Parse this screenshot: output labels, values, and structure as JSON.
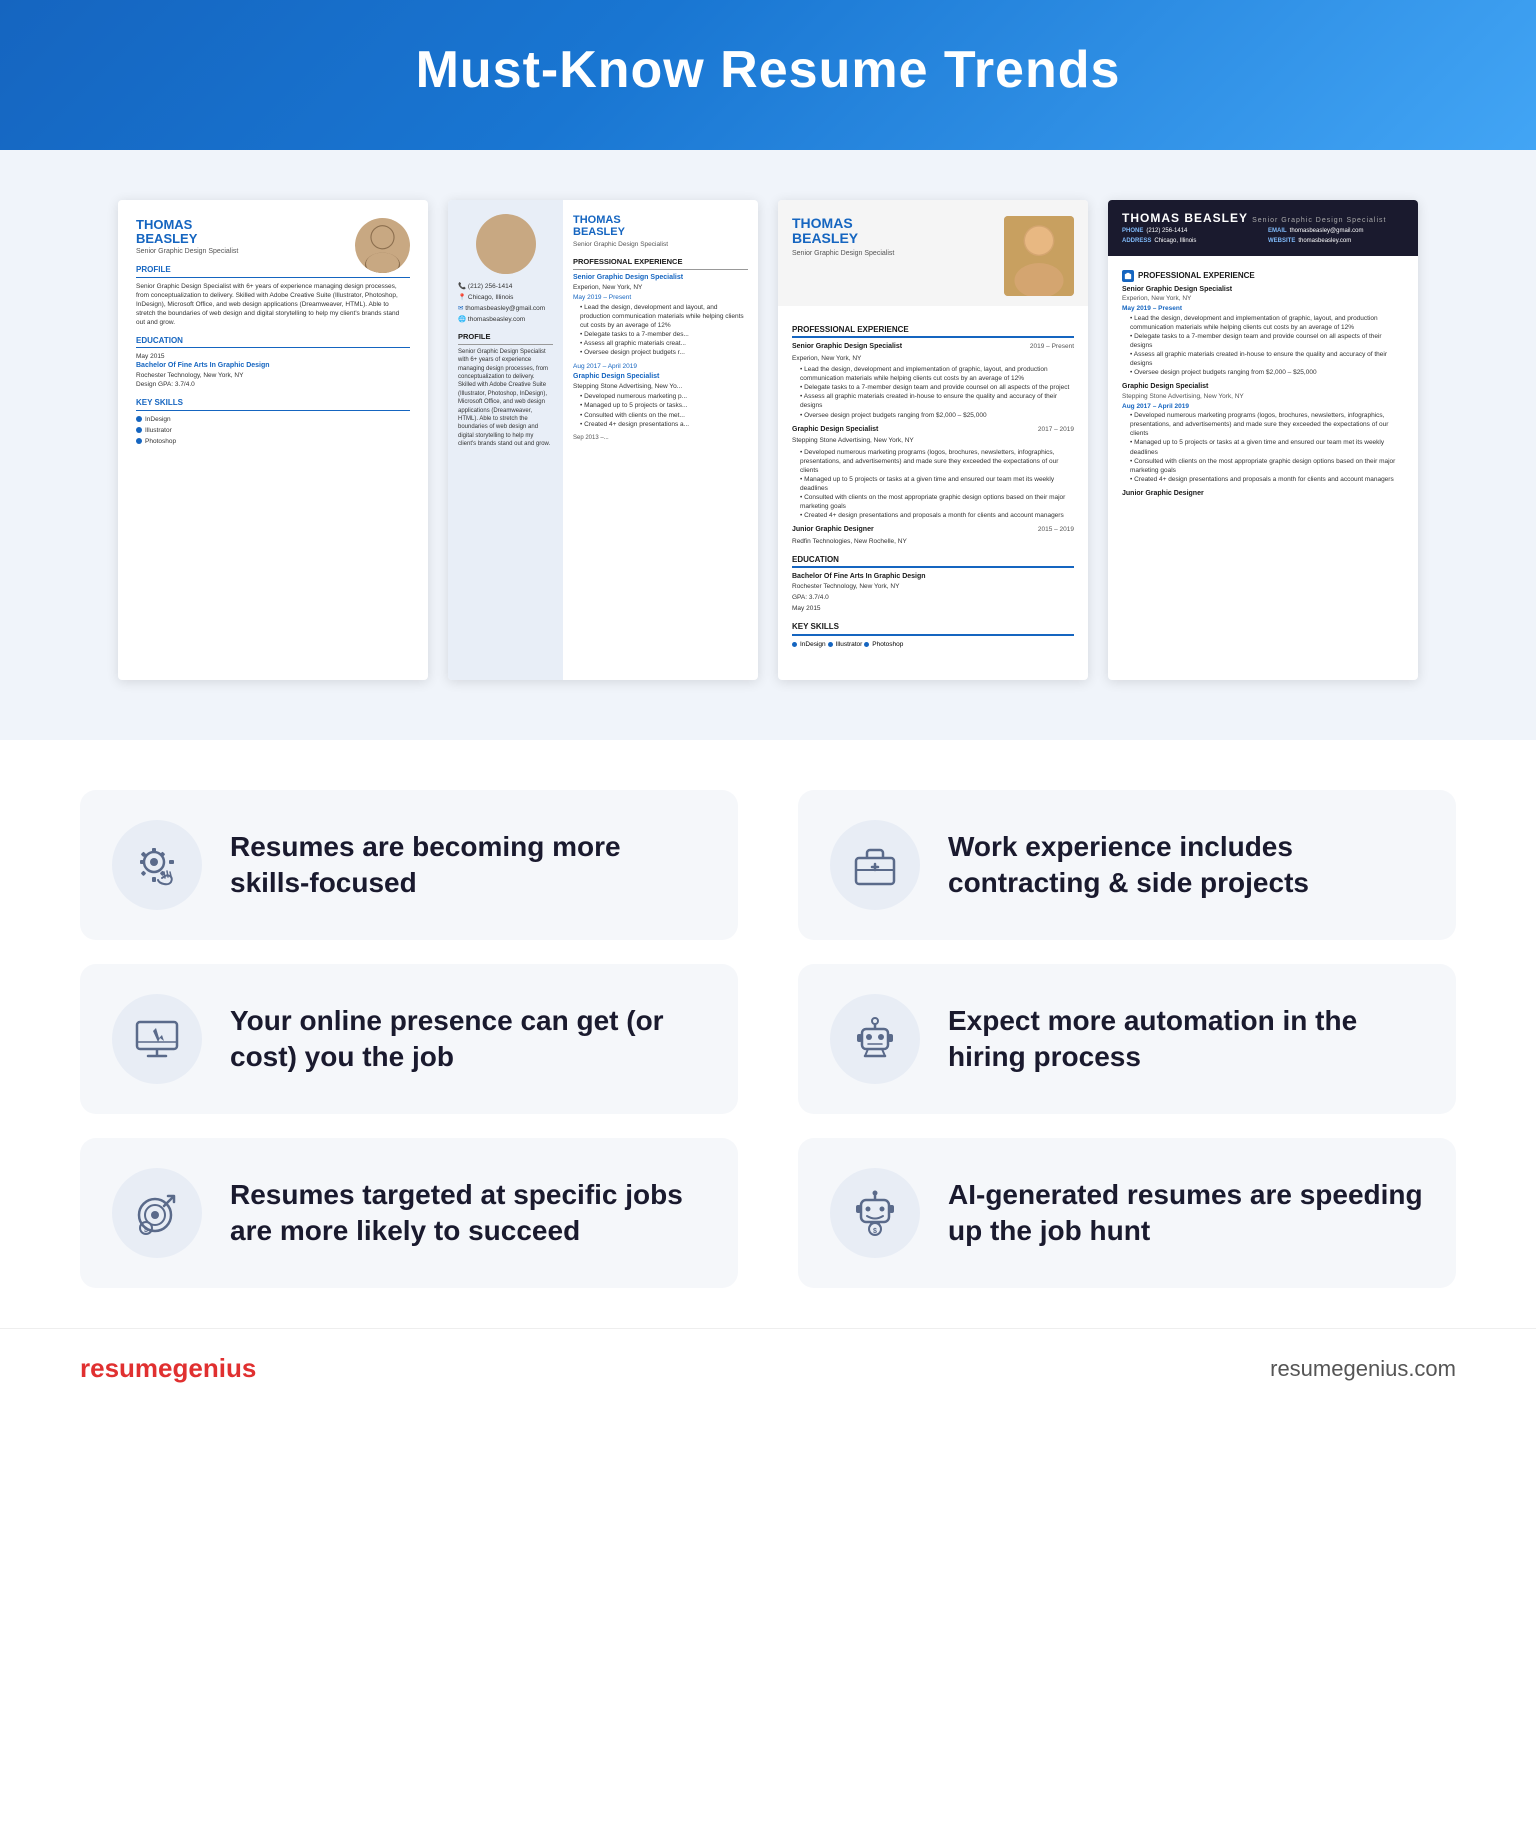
{
  "header": {
    "title": "Must-Know Resume Trends"
  },
  "resume": {
    "person": {
      "name_line1": "THOMAS",
      "name_line2": "BEASLEY",
      "title": "Senior Graphic Design Specialist",
      "phone": "(212) 256-1414",
      "city": "Chicago, Illinois",
      "email": "thomasbeasley@gmail.com",
      "website": "thomasbeasley.com",
      "profile": "Senior Graphic Design Specialist with 6+ years of experience managing design processes, from conceptualization to delivery. Skilled with Adobe Creative Suite (Illustrator, Photoshop, InDesign), Microsoft Office, and web design applications (Dreamweaver, HTML). Able to stretch the boundaries of web design and digital storytelling to help my client's brands stand out and grow.",
      "exp1_title": "Senior Graphic Design Specialist",
      "exp1_company": "Experion, New York, NY",
      "exp1_dates": "May 2019 – Present",
      "exp1_b1": "Lead the design, development and implementation of graphic, layout, and production communication materials while helping clients cut costs by an average of 12%",
      "exp1_b2": "Delegate tasks to a 7-member design team and provide counsel on all aspects of the project",
      "exp1_b3": "Assess all graphic materials created in-house to ensure the quality and accuracy of their designs",
      "exp1_b4": "Oversee design project budgets ranging from $2,000 – $25,000",
      "exp2_title": "Graphic Design Specialist",
      "exp2_company": "Stepping Stone Advertising, New York, NY",
      "exp2_dates": "Aug 2017 – April 2019",
      "exp3_title": "Junior Graphic Designer",
      "exp3_company": "Redfin Technologies, New Rochelle, NY",
      "exp3_dates": "2015 – 2019",
      "edu_degree": "Bachelor Of Fine Arts In Graphic Design",
      "edu_school": "Rochester Technology, New York, NY",
      "edu_gpa": "GPA: 3.7/4.0",
      "edu_date": "May 2015",
      "skills": [
        "InDesign",
        "Illustrator",
        "Photoshop"
      ]
    }
  },
  "trends": [
    {
      "id": "skills",
      "text": "Resumes are becoming more skills-focused",
      "icon": "skills-icon"
    },
    {
      "id": "contracting",
      "text": "Work experience includes contracting & side projects",
      "icon": "briefcase-icon"
    },
    {
      "id": "online",
      "text": "Your online presence can get (or cost) you the job",
      "icon": "monitor-icon"
    },
    {
      "id": "automation",
      "text": "Expect more automation in the hiring process",
      "icon": "robot-icon"
    },
    {
      "id": "targeted",
      "text": "Resumes targeted at specific jobs are more likely to succeed",
      "icon": "target-icon"
    },
    {
      "id": "ai",
      "text": "AI-generated resumes are speeding up the job hunt",
      "icon": "ai-icon"
    }
  ],
  "footer": {
    "logo_plain": "resume",
    "logo_bold": "genius",
    "url": "resumegenius.com"
  }
}
